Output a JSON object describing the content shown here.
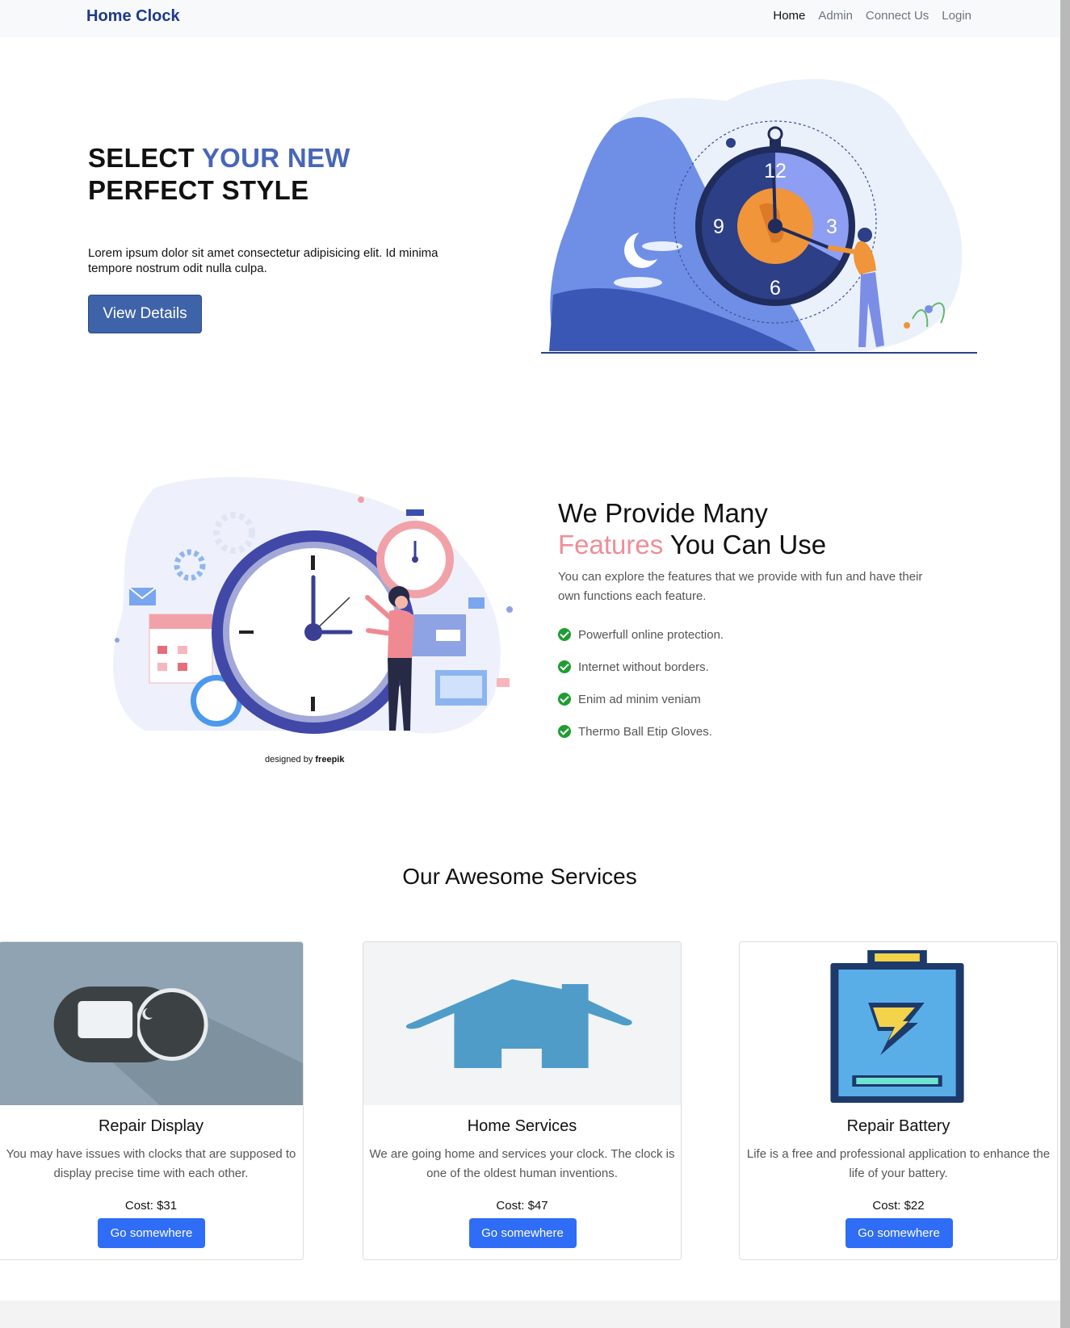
{
  "nav": {
    "brand": "Home Clock",
    "links": [
      "Home",
      "Admin",
      "Connect Us",
      "Login"
    ]
  },
  "hero": {
    "title_part1": "SELECT ",
    "title_accent": "YOUR NEW",
    "title_line2": "PERFECT STYLE",
    "text": "Lorem ipsum dolor sit amet consectetur adipisicing elit. Id minima tempore nostrum odit nulla culpa.",
    "button": "View Details",
    "clock_numbers": [
      "12",
      "3",
      "6",
      "9"
    ]
  },
  "features": {
    "title_line1": "We Provide Many",
    "title_accent": "Features",
    "title_rest": " You Can Use",
    "description": "You can explore the features that we provide with fun and have their own functions each feature.",
    "items": [
      "Powerfull online protection.",
      "Internet without borders.",
      "Enim ad minim veniam",
      "Thermo Ball Etip Gloves."
    ],
    "credit_prefix": "designed by ",
    "credit_brand": "freepik"
  },
  "services": {
    "title": "Our Awesome Services",
    "cards": [
      {
        "title": "Repair Display",
        "text": "You may have issues with clocks that are supposed to display precise time with each other.",
        "cost": "Cost: $31",
        "button": "Go somewhere"
      },
      {
        "title": "Home Services",
        "text": "We are going home and services your clock. The clock is one of the oldest human inventions.",
        "cost": "Cost: $47",
        "button": "Go somewhere"
      },
      {
        "title": "Repair Battery",
        "text": "Life is a free and professional application to enhance the life of your battery.",
        "cost": "Cost: $22",
        "button": "Go somewhere"
      }
    ]
  },
  "colors": {
    "brand": "#1e3a8a",
    "accent_blue": "#4766b8",
    "accent_pink": "#ee8e96",
    "button_primary": "#2f6df6",
    "check_green": "#1f9d33"
  }
}
